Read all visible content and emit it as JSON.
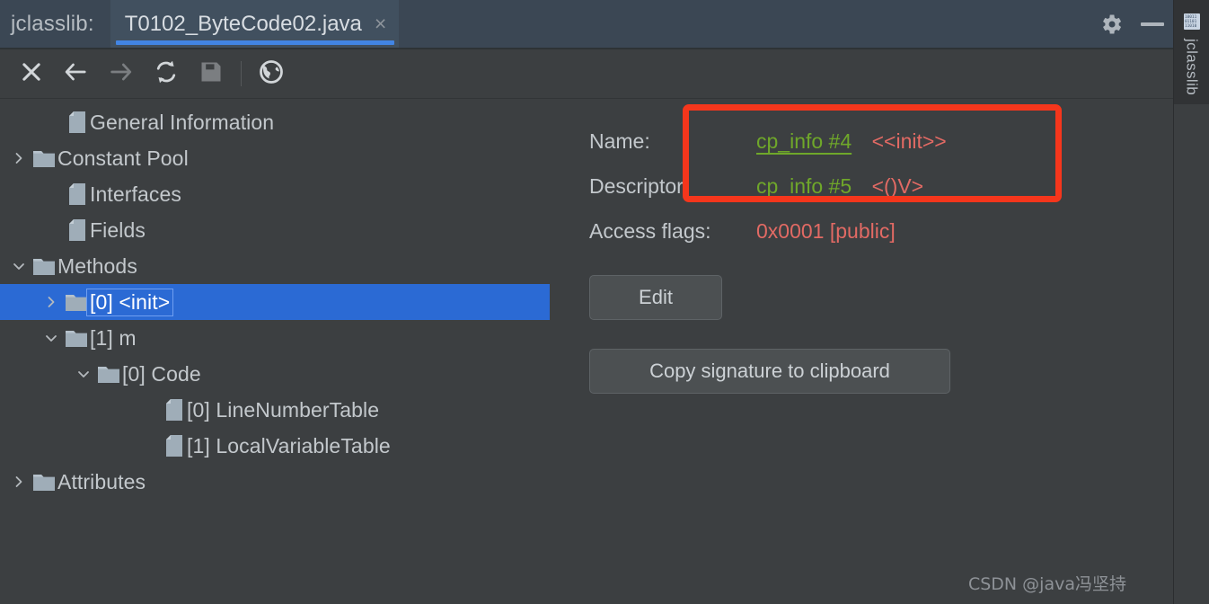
{
  "window": {
    "app_label": "jclasslib:",
    "tab_title": "T0102_ByteCode02.java",
    "tab_close_glyph": "×",
    "accent_blue": "#4285e4",
    "titlebar_bg": "#3b4754"
  },
  "toolbar": {
    "buttons": [
      {
        "name": "close-icon",
        "glyph": "close",
        "enabled": true
      },
      {
        "name": "back-icon",
        "glyph": "back",
        "enabled": true
      },
      {
        "name": "forward-icon",
        "glyph": "forward",
        "enabled": false
      },
      {
        "name": "reload-icon",
        "glyph": "reload",
        "enabled": true
      },
      {
        "name": "save-icon",
        "glyph": "save",
        "enabled": false
      },
      {
        "name": "browse-icon",
        "glyph": "globe",
        "enabled": true
      }
    ]
  },
  "tree": {
    "items": [
      {
        "label": "General Information",
        "indent": 1,
        "twisty": "none",
        "icon": "file",
        "selected": false
      },
      {
        "label": "Constant Pool",
        "indent": 0,
        "twisty": "collapsed",
        "icon": "folder",
        "selected": false
      },
      {
        "label": "Interfaces",
        "indent": 1,
        "twisty": "none",
        "icon": "file",
        "selected": false
      },
      {
        "label": "Fields",
        "indent": 1,
        "twisty": "none",
        "icon": "file",
        "selected": false
      },
      {
        "label": "Methods",
        "indent": 0,
        "twisty": "expanded",
        "icon": "folder",
        "selected": false
      },
      {
        "label": "[0] <init>",
        "indent": 1,
        "twisty": "collapsed",
        "icon": "folder",
        "selected": true
      },
      {
        "label": "[1] m",
        "indent": 1,
        "twisty": "expanded",
        "icon": "folder",
        "selected": false
      },
      {
        "label": "[0] Code",
        "indent": 2,
        "twisty": "expanded",
        "icon": "folder",
        "selected": false
      },
      {
        "label": "[0] LineNumberTable",
        "indent": 4,
        "twisty": "none",
        "icon": "file",
        "selected": false
      },
      {
        "label": "[1] LocalVariableTable",
        "indent": 4,
        "twisty": "none",
        "icon": "file",
        "selected": false
      },
      {
        "label": "Attributes",
        "indent": 0,
        "twisty": "collapsed",
        "icon": "folder",
        "selected": false
      }
    ]
  },
  "detail": {
    "name_label": "Name:",
    "name_link": "cp_info #4",
    "name_value": "<<init>>",
    "descriptor_label": "Descriptor:",
    "descriptor_link": "cp_info #5",
    "descriptor_value": "<()V>",
    "access_flags_label": "Access flags:",
    "access_flags_value": "0x0001 [public]",
    "edit_button": "Edit",
    "copy_signature_button": "Copy signature to clipboard",
    "link_color": "#6fa72a",
    "value_color": "#e26a64",
    "annotation_color": "#f5361c"
  },
  "toolstrip": {
    "tab_label": "jclasslib",
    "icon_name": "bytecode-icon"
  },
  "watermark": {
    "text": "CSDN @java冯坚持"
  }
}
